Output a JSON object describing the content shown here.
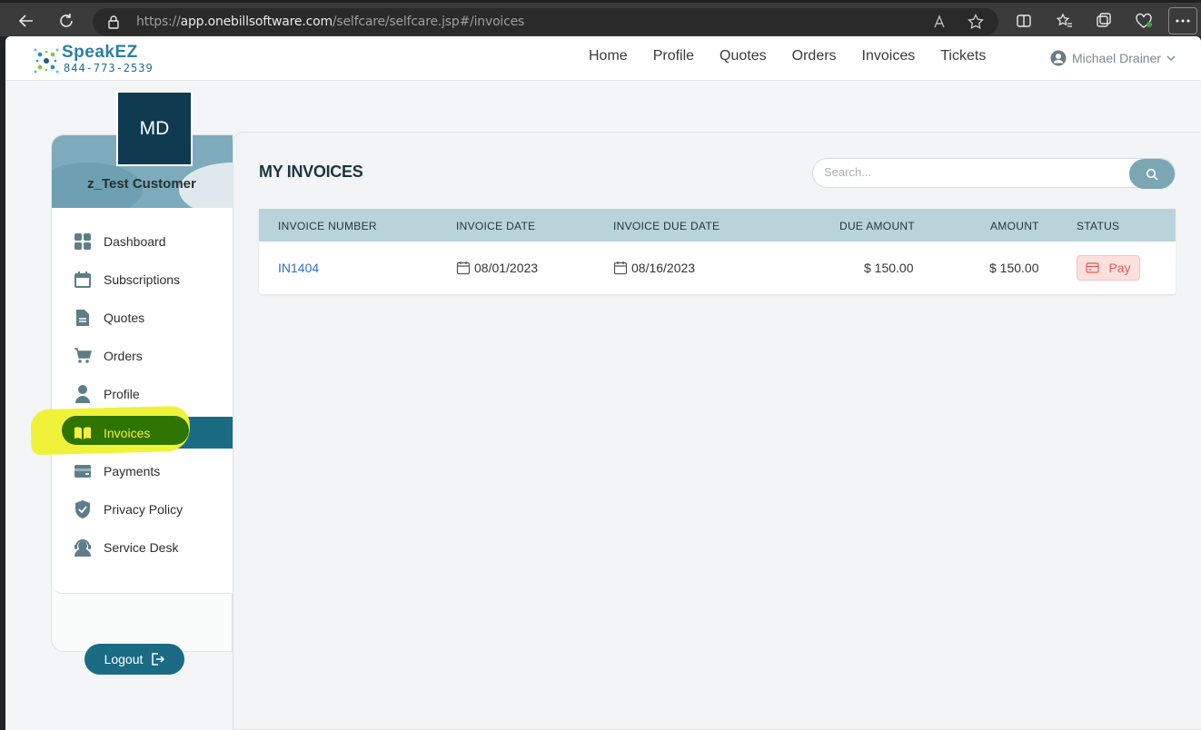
{
  "browser": {
    "url_scheme": "https://",
    "url_host": "app.onebillsoftware.com",
    "url_path": "/selfcare/selfcare.jsp#/invoices"
  },
  "header": {
    "brand": "SpeakEZ",
    "phone": "844-773-2539",
    "nav": [
      "Home",
      "Profile",
      "Quotes",
      "Orders",
      "Invoices",
      "Tickets"
    ],
    "user_name": "Michael Drainer"
  },
  "sidebar": {
    "initials": "MD",
    "customer_name": "z_Test Customer",
    "items": [
      {
        "label": "Dashboard",
        "icon": "dashboard-icon"
      },
      {
        "label": "Subscriptions",
        "icon": "calendar-icon"
      },
      {
        "label": "Quotes",
        "icon": "document-icon"
      },
      {
        "label": "Orders",
        "icon": "cart-icon"
      },
      {
        "label": "Profile",
        "icon": "user-icon"
      },
      {
        "label": "Invoices",
        "icon": "book-icon",
        "active": true
      },
      {
        "label": "Payments",
        "icon": "wallet-icon"
      },
      {
        "label": "Privacy Policy",
        "icon": "shield-icon"
      },
      {
        "label": "Service Desk",
        "icon": "headset-icon"
      }
    ],
    "logout_label": "Logout"
  },
  "main": {
    "title": "MY INVOICES",
    "search_placeholder": "Search...",
    "columns": [
      "INVOICE NUMBER",
      "INVOICE DATE",
      "INVOICE DUE DATE",
      "DUE AMOUNT",
      "AMOUNT",
      "STATUS"
    ],
    "rows": [
      {
        "invoice_number": "IN1404",
        "invoice_date": "08/01/2023",
        "due_date": "08/16/2023",
        "due_amount": "$ 150.00",
        "amount": "$ 150.00",
        "status": "Pay"
      }
    ]
  },
  "colors": {
    "primary": "#1c6b85",
    "header_row": "#b9d3db",
    "pay_bg": "#fde0de",
    "pay_text": "#e05b55",
    "highlight_yellow": "#f0f23a",
    "highlight_green": "#2e7400"
  }
}
